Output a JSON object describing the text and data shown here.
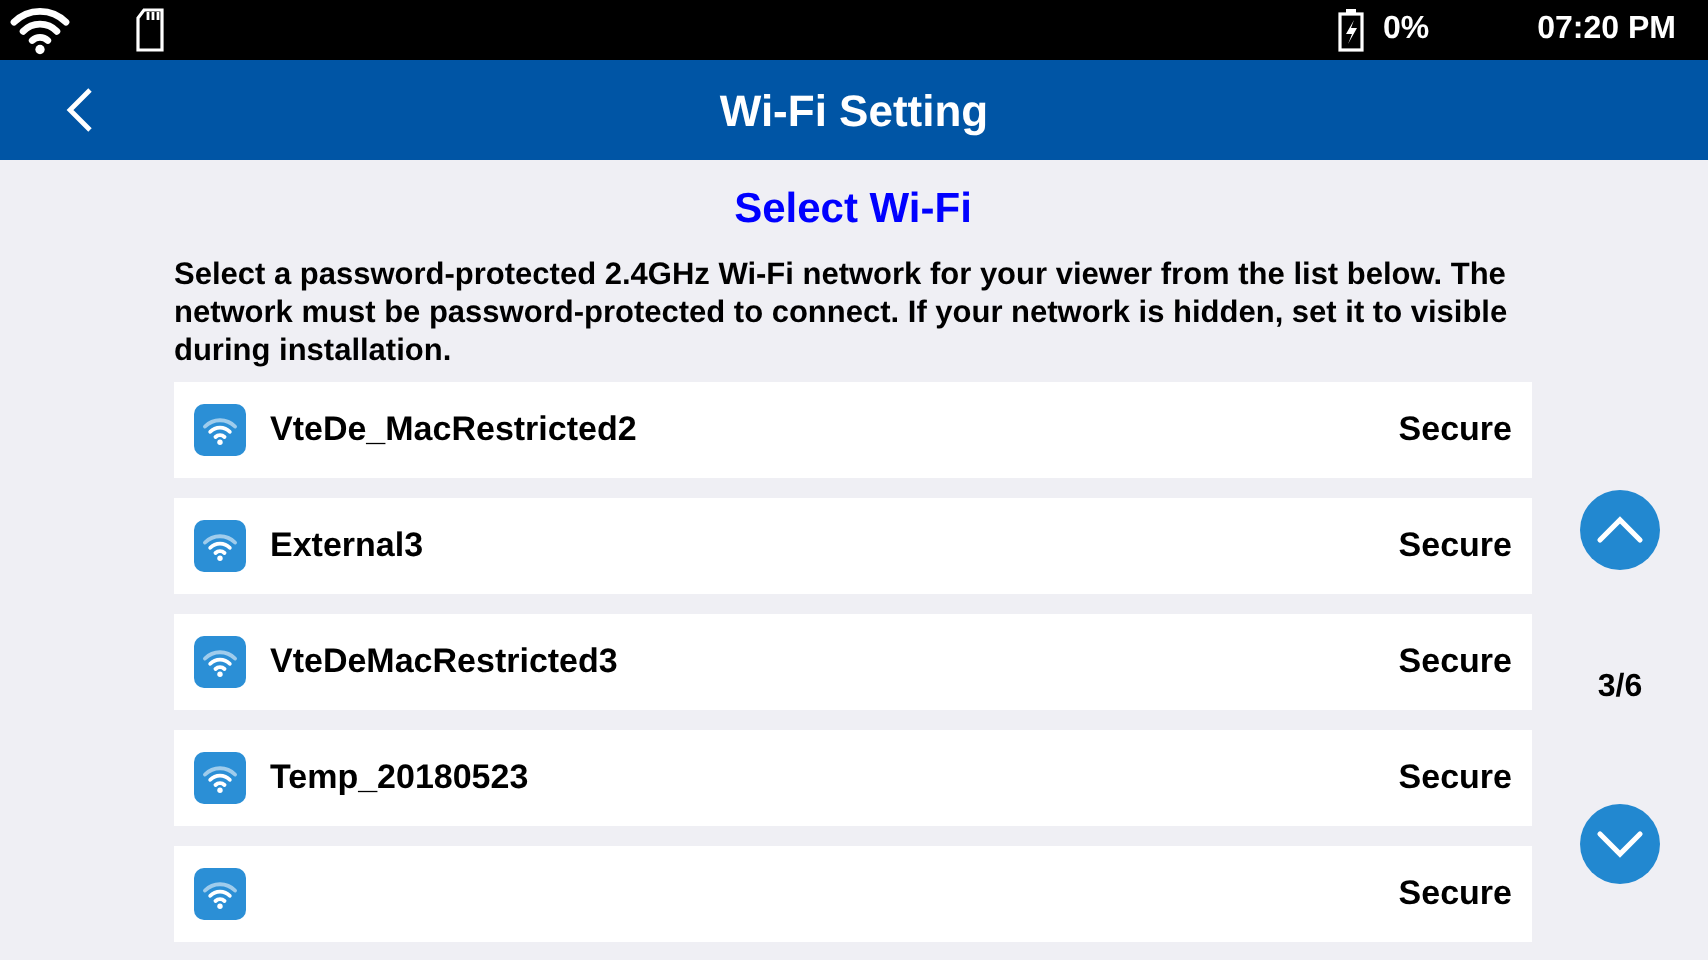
{
  "status_bar": {
    "battery": "0%",
    "time": "07:20 PM"
  },
  "header": {
    "title": "Wi-Fi Setting"
  },
  "heading": "Select Wi-Fi",
  "instructions": "Select a password-protected 2.4GHz Wi-Fi network for your viewer from the list below. The network must be password-protected to connect. If your network is hidden, set it to visible during installation.",
  "networks": [
    {
      "name": "VteDe_MacRestricted2",
      "security": "Secure"
    },
    {
      "name": "External3",
      "security": "Secure"
    },
    {
      "name": "VteDeMacRestricted3",
      "security": "Secure"
    },
    {
      "name": "Temp_20180523",
      "security": "Secure"
    },
    {
      "security": "Secure"
    }
  ],
  "pager": {
    "page": "3/6"
  }
}
